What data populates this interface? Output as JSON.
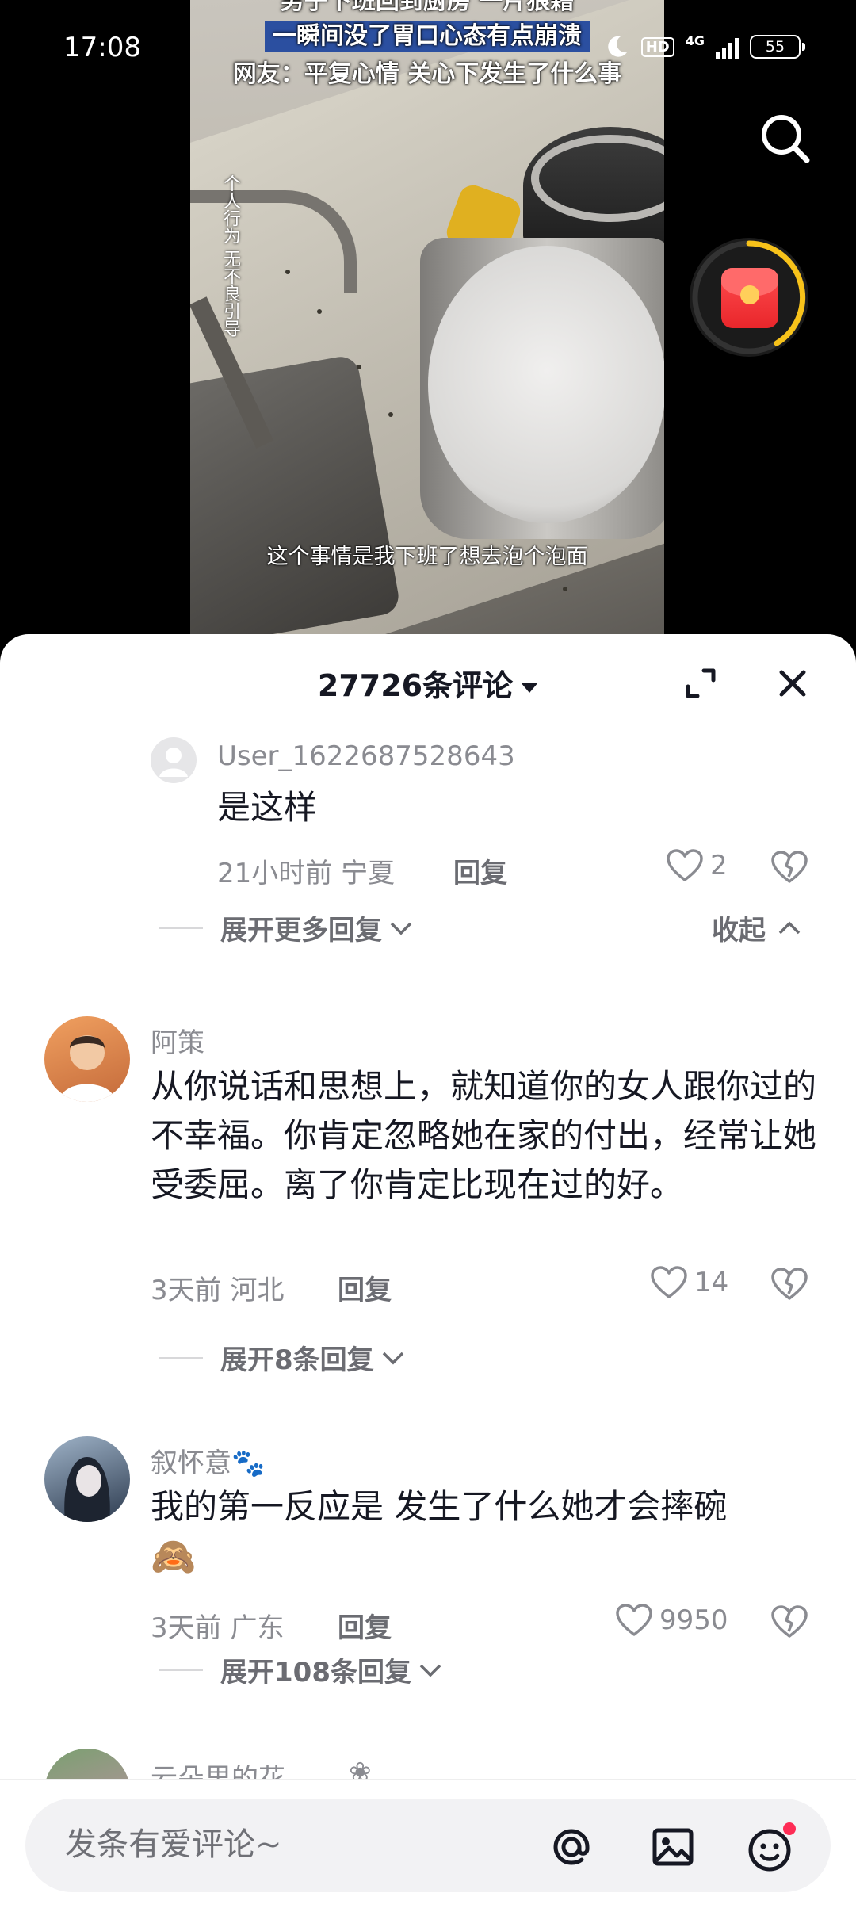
{
  "status_bar": {
    "time": "17:08",
    "network": "4G",
    "hd": "HD",
    "battery": "55"
  },
  "video": {
    "caption_line1": "男子下班回到厨房 一片狼藉",
    "caption_line2": "一瞬间没了胃口心态有点崩溃",
    "caption_line3": "网友：平复心情 关心下发生了什么事",
    "side_note": "个人行为 无不良引导",
    "subtitle": "这个事情是我下班了想去泡个泡面"
  },
  "sheet": {
    "comment_count": "27726条评论"
  },
  "comments": [
    {
      "username": "User_1622687528643",
      "text": "是这样",
      "time_location": "21小时前 宁夏",
      "reply_label": "回复",
      "likes": "2",
      "expand_label": "展开更多回复",
      "collapse_label": "收起"
    },
    {
      "username": "阿策",
      "text": "从你说话和思想上，就知道你的女人跟你过的不幸福。你肯定忽略她在家的付出，经常让她受委屈。离了你肯定比现在过的好。",
      "time_location": "3天前 河北",
      "reply_label": "回复",
      "likes": "14",
      "expand_label": "展开8条回复"
    },
    {
      "username": "叙怀意🐾",
      "text": "我的第一反应是 发生了什么她才会摔碗",
      "emoji": "🙈",
      "time_location": "3天前 广东",
      "reply_label": "回复",
      "likes": "9950",
      "expand_label": "展开108条回复"
    },
    {
      "username": "云朵里的花",
      "username_suffix": "❀"
    }
  ],
  "input_bar": {
    "placeholder": "发条有爱评论~"
  },
  "icons": {
    "search": "search-icon",
    "red_packet": "red-packet-icon",
    "expand": "expand-icon",
    "close": "close-icon",
    "like": "heart-icon",
    "dislike": "broken-heart-icon",
    "mention": "at-icon",
    "image": "image-icon",
    "emoji": "emoji-icon"
  },
  "colors": {
    "accent_red": "#fe2c55",
    "text_primary": "#161823",
    "text_secondary": "#8a8b91",
    "ring_yellow": "#f7c21a"
  }
}
